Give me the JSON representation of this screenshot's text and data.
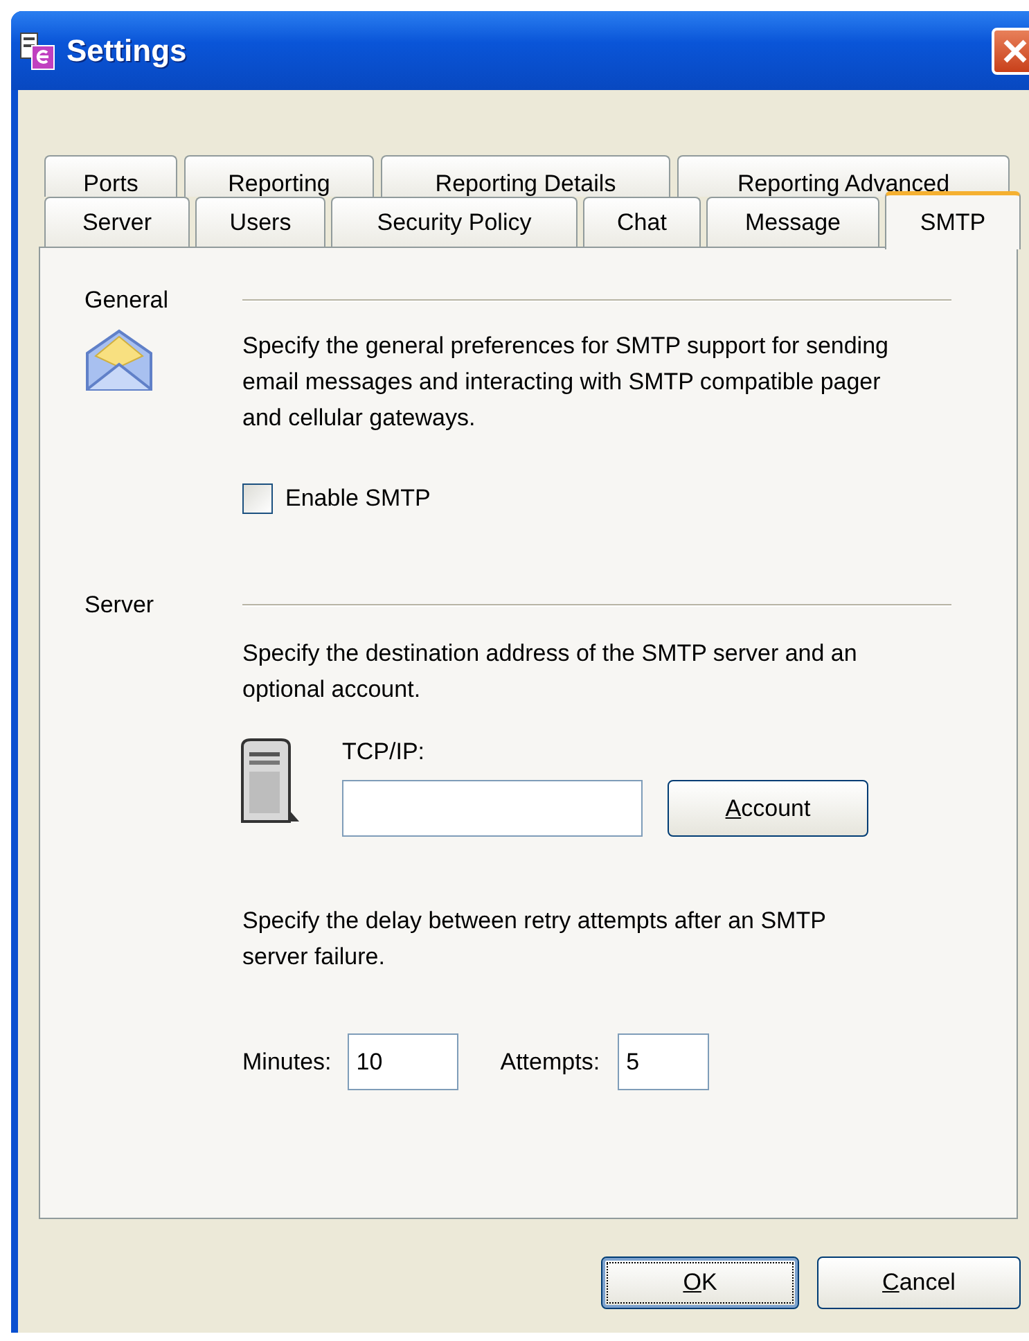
{
  "window": {
    "title": "Settings"
  },
  "tabs": {
    "back_row": [
      {
        "label": "Ports",
        "selected": false
      },
      {
        "label": "Reporting",
        "selected": false
      },
      {
        "label": "Reporting Details",
        "selected": false
      },
      {
        "label": "Reporting Advanced",
        "selected": false
      }
    ],
    "front_row": [
      {
        "label": "Server",
        "selected": false
      },
      {
        "label": "Users",
        "selected": false
      },
      {
        "label": "Security Policy",
        "selected": false
      },
      {
        "label": "Chat",
        "selected": false
      },
      {
        "label": "Message",
        "selected": false
      },
      {
        "label": "SMTP",
        "selected": true
      }
    ]
  },
  "general": {
    "heading": "General",
    "description": "Specify the general preferences for SMTP support for sending email messages and interacting with SMTP compatible pager and cellular gateways.",
    "enable_smtp": {
      "label": "Enable SMTP",
      "checked": false
    }
  },
  "server": {
    "heading": "Server",
    "description": "Specify the destination address of the SMTP server and an optional account.",
    "tcp_ip": {
      "label": "TCP/IP:"
    },
    "account_button": {
      "label": "Account",
      "mnemonic": true
    },
    "retry_description": "Specify the delay between retry attempts after an SMTP server failure.",
    "minutes": {
      "label": "Minutes:",
      "value": "10"
    },
    "attempts": {
      "label": "Attempts:",
      "value": "5"
    }
  },
  "buttons": [
    {
      "label": "OK",
      "default": true,
      "mnemonic": true
    },
    {
      "label": "Cancel",
      "default": false,
      "mnemonic": true
    }
  ]
}
